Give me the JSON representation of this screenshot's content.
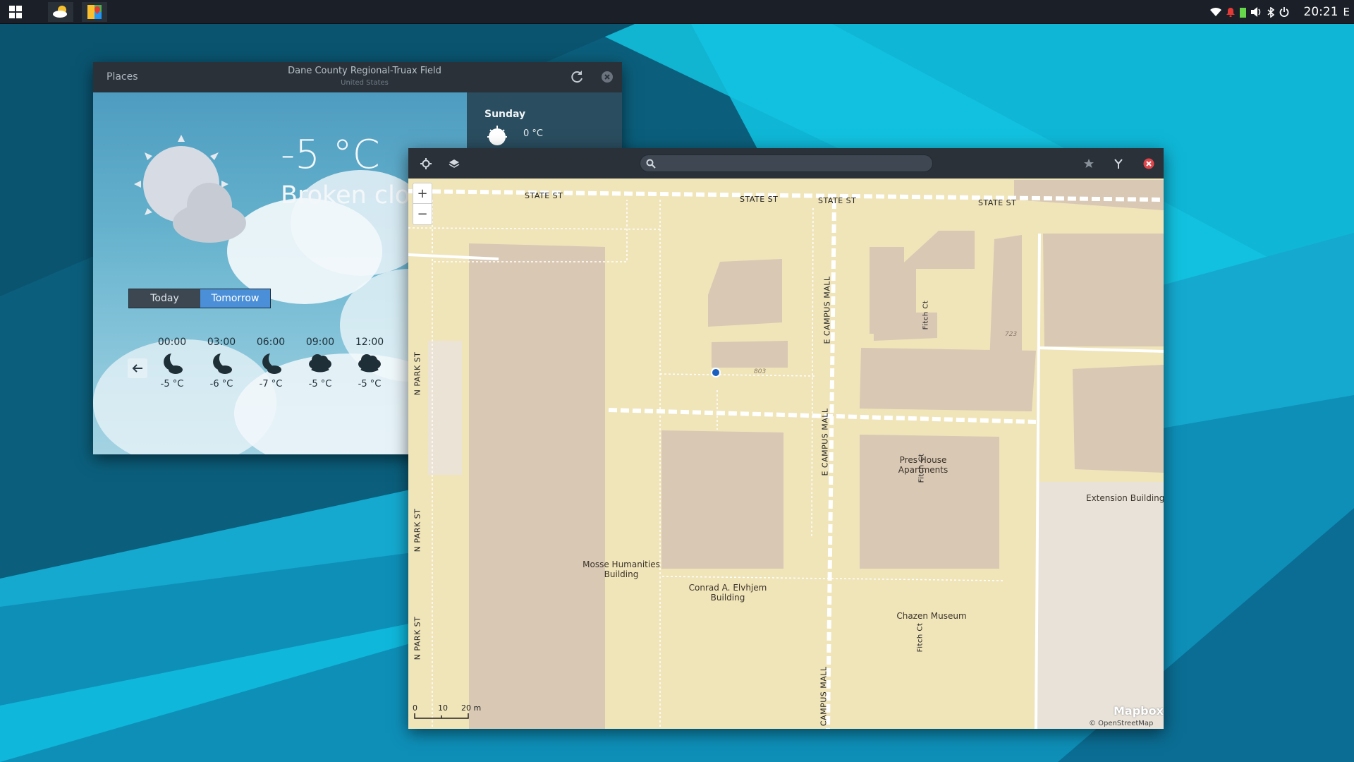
{
  "taskbar": {
    "clock": "20:21",
    "tray_extra": "E"
  },
  "weather": {
    "header": {
      "places_label": "Places",
      "location": "Dane County Regional-Truax Field",
      "country": "United States"
    },
    "current": {
      "temperature": "-5 °C",
      "condition": "Broken clou"
    },
    "toggle": {
      "today": "Today",
      "tomorrow": "Tomorrow",
      "selected": "Tomorrow"
    },
    "hourly": [
      {
        "time": "00:00",
        "icon": "moon-cloud-icon",
        "temp": "-5 °C"
      },
      {
        "time": "03:00",
        "icon": "moon-cloud-icon",
        "temp": "-6 °C"
      },
      {
        "time": "06:00",
        "icon": "moon-cloud-icon",
        "temp": "-7 °C"
      },
      {
        "time": "09:00",
        "icon": "cloudy-icon",
        "temp": "-5 °C"
      },
      {
        "time": "12:00",
        "icon": "cloudy-icon",
        "temp": "-5 °C"
      }
    ],
    "daily": {
      "day": "Sunday",
      "temp": "0 °C"
    }
  },
  "maps": {
    "search_placeholder": "",
    "zoom_in": "+",
    "zoom_out": "−",
    "streets": {
      "state_st_1": "STATE ST",
      "state_st_2": "STATE ST",
      "state_st_3": "STATE ST",
      "state_st_4": "STATE ST",
      "e_campus_mall_1": "E CAMPUS MALL",
      "e_campus_mall_2": "E CAMPUS MALL",
      "e_campus_mall_3": "E CAMPUS MALL",
      "n_park_st_1": "N PARK ST",
      "n_park_st_2": "N PARK ST",
      "n_park_st_3": "N PARK ST",
      "fitch_ct_1": "Fitch Ct",
      "fitch_ct_2": "Fitch Ct",
      "fitch_ct_3": "Fitch Ct"
    },
    "buildings": {
      "pres_house": "Pres House Apartments",
      "extension": "Extension Building",
      "mosse": "Mosse Humanities Building",
      "elvehjem": "Conrad A. Elvhjem Building",
      "chazen": "Chazen Museum"
    },
    "house_numbers": {
      "n803": "803",
      "n723": "723"
    },
    "scale": {
      "s0": "0",
      "s10": "10",
      "s20": "20 m"
    },
    "attribution": {
      "mapbox": "Mapbox",
      "osm": "© OpenStreetMap"
    }
  },
  "colors": {
    "accent": "#4a8fd8",
    "map_land": "#f0e4b9",
    "map_building": "#d8c8b4",
    "close_red": "#e0454b"
  }
}
